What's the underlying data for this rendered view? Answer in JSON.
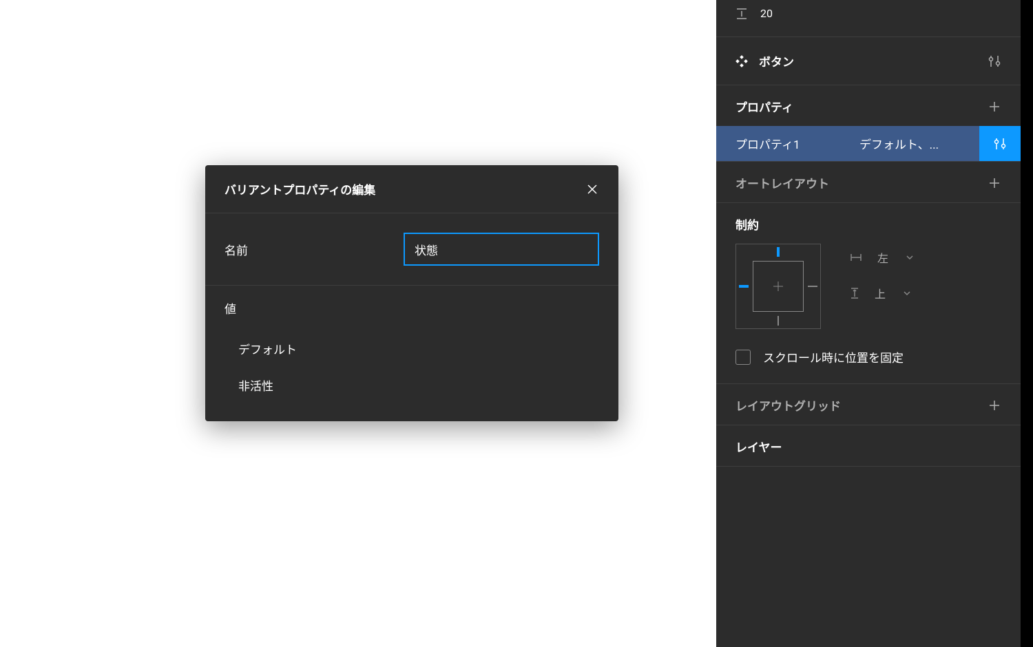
{
  "spacing": {
    "value": "20"
  },
  "component": {
    "name": "ボタン"
  },
  "properties": {
    "section_title": "プロパティ",
    "items": [
      {
        "name": "プロパティ1",
        "value": "デフォルト、..."
      }
    ]
  },
  "auto_layout": {
    "section_title": "オートレイアウト"
  },
  "constraints": {
    "section_title": "制約",
    "horizontal": "左",
    "vertical": "上",
    "fix_position_label": "スクロール時に位置を固定"
  },
  "layout_grid": {
    "section_title": "レイアウトグリッド"
  },
  "layer": {
    "section_title": "レイヤー"
  },
  "modal": {
    "title": "バリアントプロパティの編集",
    "name_label": "名前",
    "name_value": "状態",
    "values_label": "値",
    "values": [
      "デフォルト",
      "非活性"
    ]
  }
}
